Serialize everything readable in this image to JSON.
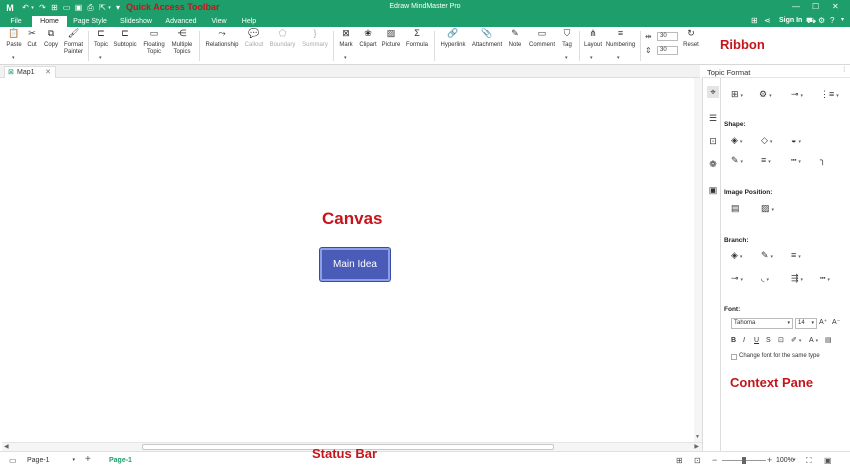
{
  "app": {
    "title": "Edraw MindMaster Pro"
  },
  "annotations": {
    "quick_access_toolbar": "Quick Access Toolbar",
    "ribbon": "Ribbon",
    "canvas": "Canvas",
    "status_bar": "Status Bar",
    "context_pane": "Context Pane"
  },
  "menu": {
    "tabs": [
      "File",
      "Home",
      "Page Style",
      "Slideshow",
      "Advanced",
      "View",
      "Help"
    ],
    "active": "Home",
    "sign_in": "Sign In"
  },
  "ribbon": {
    "paste": "Paste",
    "cut": "Cut",
    "copy": "Copy",
    "format_painter_1": "Format",
    "format_painter_2": "Painter",
    "topic": "Topic",
    "subtopic": "Subtopic",
    "floating_topic_1": "Floating",
    "floating_topic_2": "Topic",
    "multiple_topics_1": "Multiple",
    "multiple_topics_2": "Topics",
    "relationship": "Relationship",
    "callout": "Callout",
    "boundary": "Boundary",
    "summary": "Summary",
    "mark": "Mark",
    "clipart": "Clipart",
    "picture": "Picture",
    "formula": "Formula",
    "hyperlink": "Hyperlink",
    "attachment": "Attachment",
    "note": "Note",
    "comment": "Comment",
    "tag": "Tag",
    "layout": "Layout",
    "numbering": "Numbering",
    "spacing_1": "30",
    "spacing_2": "30",
    "reset": "Reset"
  },
  "document": {
    "tab": "Map1"
  },
  "canvas": {
    "main_topic": "Main Idea",
    "main_topic_color": "#4a5bb8"
  },
  "pane": {
    "title": "Topic Format",
    "shape": "Shape:",
    "image_position": "Image Position:",
    "branch": "Branch:",
    "font": "Font:",
    "font_name": "Tahoma",
    "font_size": "14",
    "change_font": "Change font for the same type"
  },
  "status": {
    "page_select": "Page-1",
    "page_tab": "Page-1",
    "zoom": "100%"
  },
  "colors": {
    "brand": "#1e9e6a",
    "annotation": "#c4151c"
  }
}
